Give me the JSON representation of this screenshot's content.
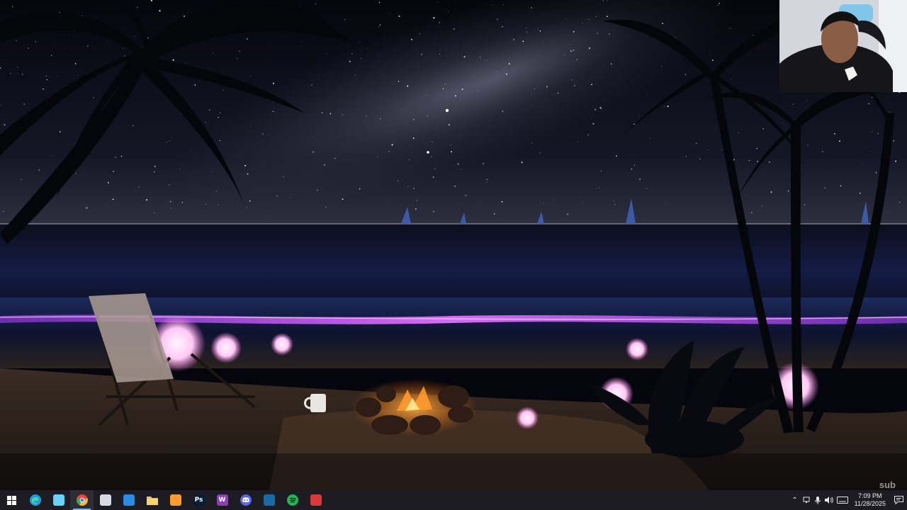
{
  "wallpaper": {
    "description_icon": "night-beach-wallpaper",
    "colors": {
      "sky_top": "#05060d",
      "sky_horizon": "#2a2c3c",
      "sea": "#10142e",
      "glow": "#c040ff",
      "sand": "#3a2c24",
      "orb": "#ffd8ff",
      "fire": "#ff9a30"
    }
  },
  "webcam": {
    "icon": "webcam-overlay"
  },
  "watermark": "sub",
  "taskbar": {
    "apps": [
      {
        "name": "start",
        "icon": "windows-start-icon",
        "label": "",
        "color": "#ffffff",
        "active": false
      },
      {
        "name": "edge",
        "icon": "edge-icon",
        "label": "",
        "color": "#1f9bde",
        "active": false
      },
      {
        "name": "copilot",
        "icon": "copilot-icon",
        "label": "",
        "color": "#6ad1ff",
        "active": false
      },
      {
        "name": "chrome",
        "icon": "chrome-icon",
        "label": "",
        "color": "#e8453c",
        "active": true
      },
      {
        "name": "app-bird",
        "icon": "bird-app-icon",
        "label": "",
        "color": "#d9d9e6",
        "active": false
      },
      {
        "name": "vscode",
        "icon": "vscode-icon",
        "label": "",
        "color": "#2b8ce6",
        "active": false
      },
      {
        "name": "explorer",
        "icon": "folder-icon",
        "label": "",
        "color": "#f2c14b",
        "active": false
      },
      {
        "name": "sublime",
        "icon": "sublime-icon",
        "label": "",
        "color": "#ff9a30",
        "active": false
      },
      {
        "name": "photoshop",
        "icon": "photoshop-icon",
        "label": "Ps",
        "color": "#001e36",
        "active": false
      },
      {
        "name": "app-w",
        "icon": "w-app-icon",
        "label": "W",
        "color": "#8c3fb5",
        "active": false
      },
      {
        "name": "discord",
        "icon": "discord-icon",
        "label": "",
        "color": "#5865f2",
        "active": false
      },
      {
        "name": "steam",
        "icon": "steam-icon",
        "label": "",
        "color": "#1b6aa8",
        "active": false
      },
      {
        "name": "spotify",
        "icon": "spotify-icon",
        "label": "",
        "color": "#1db954",
        "active": false
      },
      {
        "name": "app-red",
        "icon": "red-app-icon",
        "label": "",
        "color": "#d83a3a",
        "active": false
      }
    ],
    "tray": {
      "icons": [
        "chevron-up-icon",
        "network-icon",
        "microphone-icon",
        "speaker-icon",
        "keyboard-icon"
      ],
      "time": "7:09 PM",
      "date": "11/28/2025",
      "notification_icon": "notification-icon"
    }
  }
}
